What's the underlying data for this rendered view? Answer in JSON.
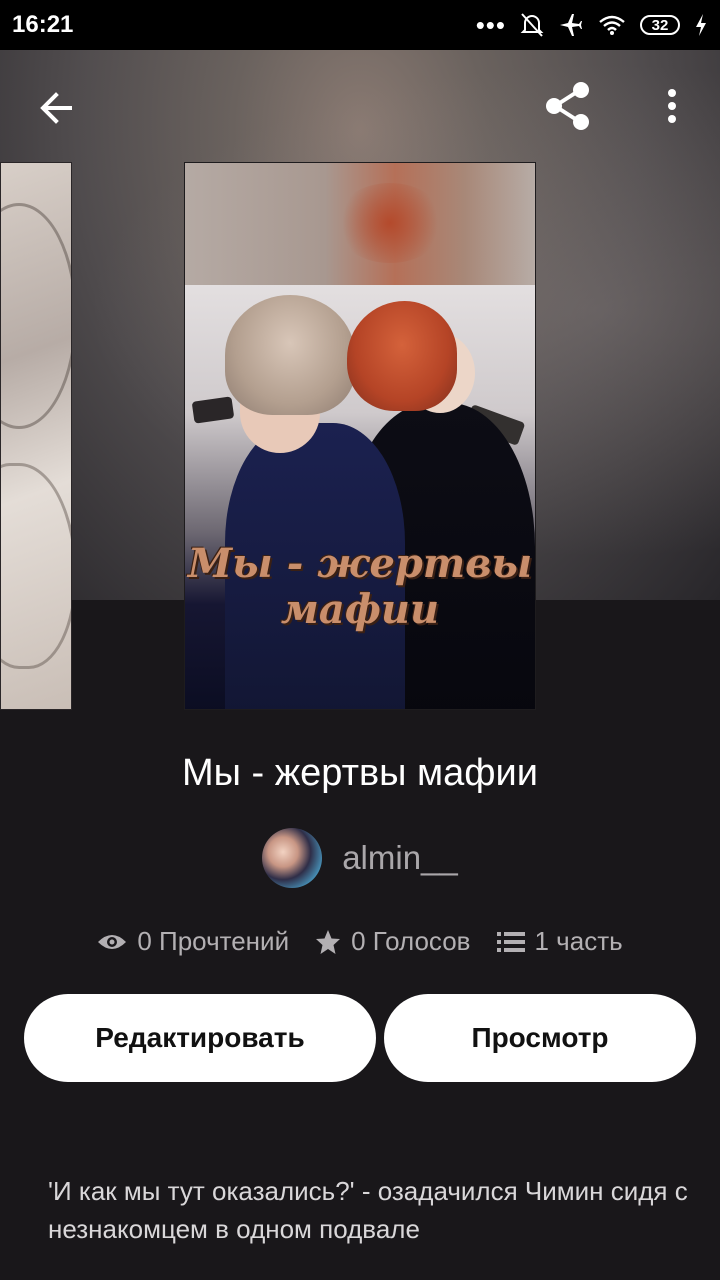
{
  "status_bar": {
    "time": "16:21",
    "battery": "32",
    "icons": [
      "more-dots-icon",
      "notifications-off-icon",
      "airplane-icon",
      "wifi-icon",
      "battery-icon",
      "charging-icon"
    ]
  },
  "toolbar": {
    "icons": [
      "back-arrow-icon",
      "share-icon",
      "more-vertical-icon"
    ]
  },
  "cover": {
    "title_line1": "Мы - жертвы",
    "title_line2": "мафии"
  },
  "story": {
    "title": "Мы - жертвы мафии",
    "author": "almin__",
    "stats": {
      "reads": "0 Прочтений",
      "votes": "0 Голосов",
      "parts": "1 часть"
    },
    "description": "'И как мы тут оказались?' - озадачился Чимин сидя с незнакомцем в одном подвале"
  },
  "actions": {
    "edit_label": "Редактировать",
    "view_label": "Просмотр"
  },
  "colors": {
    "background": "#19171a",
    "button_bg": "#ffffff",
    "cover_title": "#c98e6b"
  }
}
